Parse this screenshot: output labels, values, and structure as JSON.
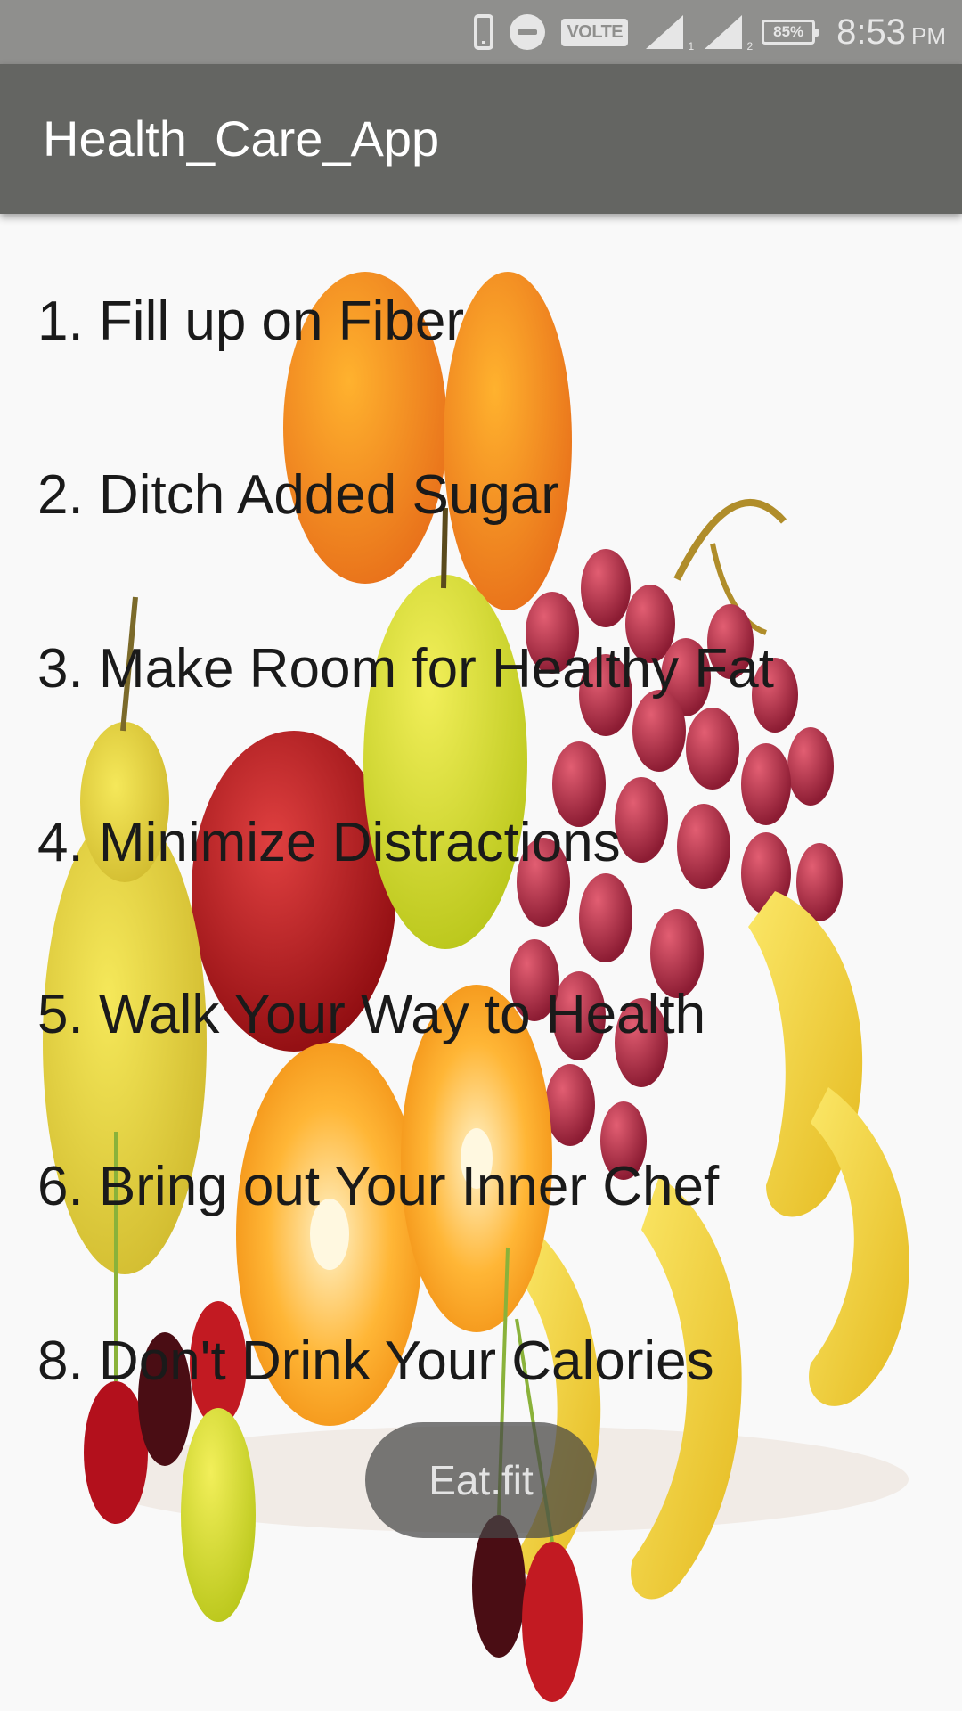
{
  "status_bar": {
    "icons": [
      "phone-icon",
      "do-not-disturb-icon",
      "volte-icon",
      "signal-sim1-icon",
      "signal-sim2-icon",
      "battery-icon"
    ],
    "volte_label": "VOLTE",
    "sim1_label": "1",
    "sim2_label": "2",
    "battery_level": "85%",
    "time": "8:53",
    "ampm": "PM"
  },
  "app_bar": {
    "title": "Health_Care_App"
  },
  "tips": [
    "1. Fill up on Fiber",
    "2. Ditch Added Sugar",
    "3. Make Room for Healthy Fat",
    "4. Minimize Distractions",
    "5. Walk Your Way to Health",
    "6. Bring out Your Inner Chef",
    "8. Don't Drink Your Calories"
  ],
  "button": {
    "label": "Eat.fit"
  },
  "colors": {
    "status_bar": "#8f8f8d",
    "app_bar": "#646562",
    "background": "#f9f9f9",
    "tip_text": "#1a1a1a"
  }
}
